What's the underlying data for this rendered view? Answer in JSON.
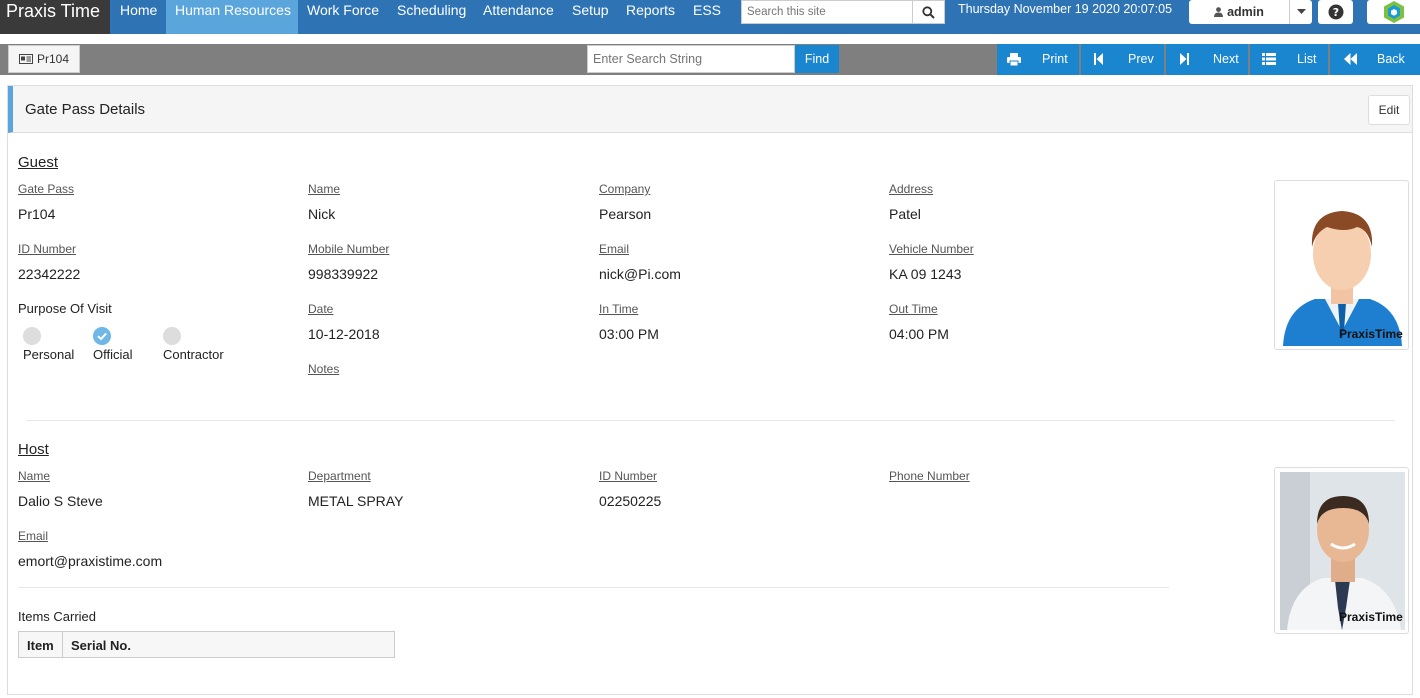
{
  "app": {
    "brand": "Praxis Time",
    "nav": [
      "Home",
      "Human Resources",
      "Work Force",
      "Scheduling",
      "Attendance",
      "Setup",
      "Reports",
      "ESS"
    ],
    "active_nav": "Human Resources",
    "search_placeholder": "Search this site",
    "datetime": "Thursday November 19 2020 20:07:05",
    "user": "admin"
  },
  "toolbar": {
    "record": "Pr104",
    "search_placeholder": "Enter Search String",
    "find": "Find",
    "print": "Print",
    "prev": "Prev",
    "next": "Next",
    "list": "List",
    "back": "Back"
  },
  "panel": {
    "title": "Gate Pass Details",
    "edit": "Edit"
  },
  "guest": {
    "section": "Guest",
    "gate_pass_label": "Gate Pass",
    "gate_pass": "Pr104",
    "name_label": "Name",
    "name": "Nick",
    "company_label": "Company",
    "company": "Pearson",
    "address_label": "Address",
    "address": "Patel",
    "id_label": "ID Number",
    "id": "22342222",
    "mobile_label": "Mobile Number",
    "mobile": "998339922",
    "email_label": "Email",
    "email": "nick@Pi.com",
    "vehicle_label": "Vehicle Number",
    "vehicle": "KA 09 1243",
    "purpose_label": "Purpose Of Visit",
    "purpose_options": [
      "Personal",
      "Official",
      "Contractor"
    ],
    "purpose_selected": "Official",
    "date_label": "Date",
    "date": "10-12-2018",
    "in_label": "In Time",
    "in_time": "03:00 PM",
    "out_label": "Out Time",
    "out_time": "04:00 PM",
    "notes_label": "Notes",
    "watermark": "PraxisTime"
  },
  "host": {
    "section": "Host",
    "name_label": "Name",
    "name": "Dalio S Steve",
    "dept_label": "Department",
    "dept": "METAL SPRAY",
    "id_label": "ID Number",
    "id": "02250225",
    "phone_label": "Phone Number",
    "email_label": "Email",
    "email": "emort@praxistime.com",
    "items_label": "Items Carried",
    "items_cols": [
      "Item",
      "Serial No."
    ],
    "watermark": "PraxisTime"
  },
  "colors": {
    "nav": "#2e74b5",
    "nav_active": "#5aa6dc",
    "button": "#1a86d0",
    "brand_bg": "#3a3a3a"
  }
}
